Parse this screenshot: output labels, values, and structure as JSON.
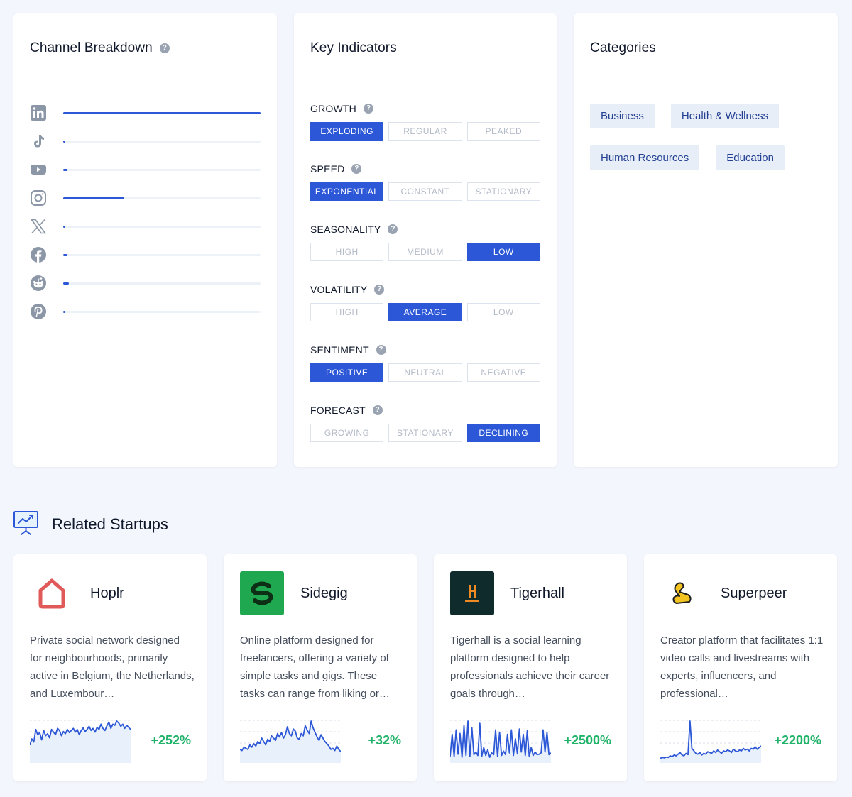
{
  "channel_breakdown": {
    "title": "Channel Breakdown",
    "help": "?",
    "channels": [
      {
        "name": "linkedin-icon",
        "fraction": 1.0
      },
      {
        "name": "tiktok-icon",
        "fraction": 0.01
      },
      {
        "name": "youtube-icon",
        "fraction": 0.02
      },
      {
        "name": "instagram-icon",
        "fraction": 0.31
      },
      {
        "name": "x-icon",
        "fraction": 0.005
      },
      {
        "name": "facebook-icon",
        "fraction": 0.02
      },
      {
        "name": "reddit-icon",
        "fraction": 0.03
      },
      {
        "name": "pinterest-icon",
        "fraction": 0.005
      }
    ],
    "accent": "#2c57d6"
  },
  "key_indicators": {
    "title": "Key Indicators",
    "help": "?",
    "rows": [
      {
        "label": "GROWTH",
        "options": [
          "EXPLODING",
          "REGULAR",
          "PEAKED"
        ],
        "selected": 0
      },
      {
        "label": "SPEED",
        "options": [
          "EXPONENTIAL",
          "CONSTANT",
          "STATIONARY"
        ],
        "selected": 0
      },
      {
        "label": "SEASONALITY",
        "options": [
          "HIGH",
          "MEDIUM",
          "LOW"
        ],
        "selected": 2
      },
      {
        "label": "VOLATILITY",
        "options": [
          "HIGH",
          "AVERAGE",
          "LOW"
        ],
        "selected": 1
      },
      {
        "label": "SENTIMENT",
        "options": [
          "POSITIVE",
          "NEUTRAL",
          "NEGATIVE"
        ],
        "selected": 0
      },
      {
        "label": "FORECAST",
        "options": [
          "GROWING",
          "STATIONARY",
          "DECLINING"
        ],
        "selected": 2
      }
    ]
  },
  "categories": {
    "title": "Categories",
    "tags": [
      "Business",
      "Health & Wellness",
      "Human Resources",
      "Education"
    ]
  },
  "related_startups": {
    "title": "Related Startups",
    "startups": [
      {
        "name": "Hoplr",
        "description": "Private social network designed for neighbourhoods, primarily active in Belgium, the Netherlands, and Luxembour…",
        "growth": "+252%",
        "spark": [
          30,
          42,
          36,
          60,
          50,
          54,
          40,
          58,
          48,
          52,
          44,
          60,
          55,
          50,
          62,
          58,
          48,
          56,
          52,
          60,
          54,
          58,
          62,
          55,
          60,
          50,
          58,
          63,
          56,
          60,
          66,
          58,
          62,
          55,
          64,
          60,
          70,
          62,
          58,
          67,
          74,
          62,
          70,
          68,
          76,
          72,
          66,
          70,
          62,
          68,
          64,
          60
        ],
        "logo_color": "#e05a5a"
      },
      {
        "name": "Sidegig",
        "description": "Online platform designed for freelancers, offering a variety of simple tasks and gigs. These tasks can range from liking or…",
        "growth": "+32%",
        "spark": [
          20,
          18,
          24,
          22,
          20,
          28,
          24,
          30,
          26,
          34,
          30,
          40,
          34,
          28,
          38,
          34,
          44,
          40,
          36,
          48,
          42,
          50,
          40,
          46,
          60,
          48,
          44,
          56,
          52,
          40,
          38,
          48,
          44,
          62,
          54,
          48,
          70,
          58,
          50,
          42,
          36,
          46,
          40,
          34,
          30,
          26,
          20,
          22,
          18,
          26,
          20,
          16
        ],
        "logo_color": "#1fa84f"
      },
      {
        "name": "Tigerhall",
        "description": "Tigerhall is a social learning platform designed to help professionals achieve their career goals through…",
        "growth": "+2500%",
        "spark": [
          10,
          60,
          10,
          70,
          15,
          62,
          8,
          80,
          12,
          90,
          10,
          75,
          14,
          20,
          12,
          85,
          10,
          30,
          12,
          25,
          8,
          18,
          14,
          70,
          10,
          65,
          12,
          22,
          14,
          60,
          18,
          70,
          12,
          50,
          16,
          72,
          20,
          60,
          12,
          68,
          10,
          30,
          12,
          20,
          14,
          15,
          18,
          70,
          20,
          65,
          14,
          18
        ],
        "logo_color": "#0f2b2b"
      },
      {
        "name": "Superpeer",
        "description": "Creator platform that facilitates 1:1 video calls and livestreams with experts, influencers, and professional…",
        "growth": "+2200%",
        "spark": [
          6,
          8,
          7,
          9,
          8,
          12,
          10,
          14,
          12,
          16,
          20,
          14,
          12,
          18,
          15,
          96,
          30,
          24,
          18,
          16,
          20,
          14,
          18,
          16,
          22,
          20,
          18,
          24,
          20,
          26,
          22,
          18,
          24,
          22,
          26,
          24,
          20,
          28,
          24,
          22,
          26,
          24,
          30,
          26,
          28,
          24,
          30,
          28,
          34,
          28,
          32,
          36
        ],
        "logo_color": "#f3c320"
      }
    ]
  }
}
